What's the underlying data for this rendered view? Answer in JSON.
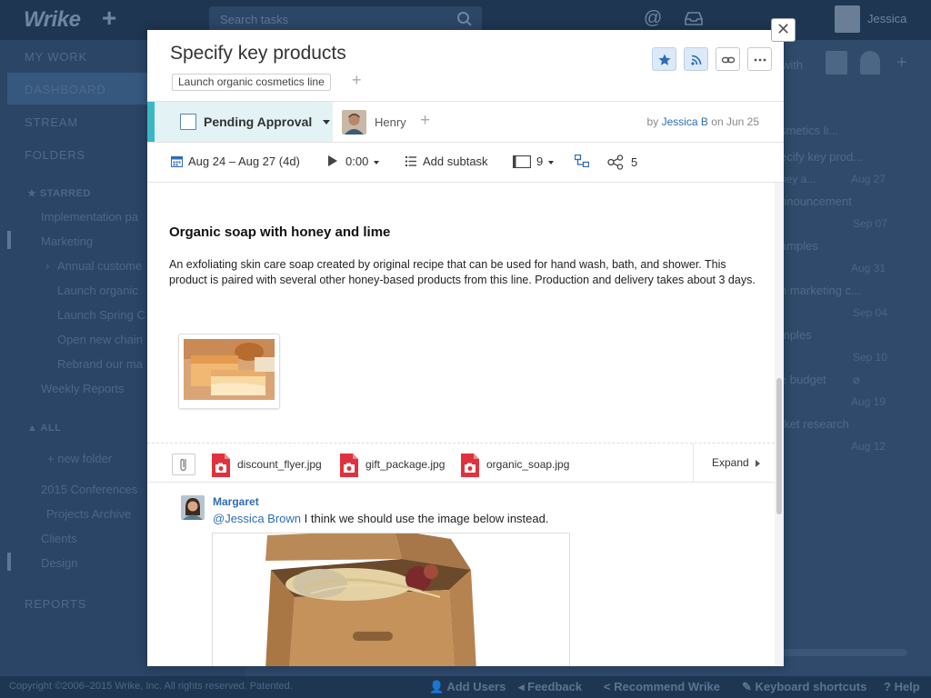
{
  "app": {
    "logo": "Wrike",
    "search_placeholder": "Search tasks",
    "user_name": "Jessica"
  },
  "sidebar": {
    "items": [
      "MY WORK",
      "DASHBOARD",
      "STREAM",
      "FOLDERS"
    ],
    "starred_label": "STARRED",
    "starred_items": [
      "Implementation pa",
      "Marketing",
      "Annual custome",
      "Launch organic",
      "Launch Spring C",
      "Open new chain",
      "Rebrand our ma",
      "Weekly Reports"
    ],
    "all_label": "ALL",
    "new_folder": "new folder",
    "all_items": [
      "2015 Conferences",
      "Projects Archive",
      "Clients",
      "Design"
    ],
    "reports": "REPORTS"
  },
  "right_panel": {
    "share_with": "with",
    "tasks": [
      {
        "title": "smetics li...",
        "date": ""
      },
      {
        "title": "ecify key prod...",
        "date": "Aug 27"
      },
      {
        "title": "ney a...",
        "date": ""
      },
      {
        "title": "nnouncement",
        "date": "Sep 07"
      },
      {
        "title": "amples",
        "date": "Aug 31"
      },
      {
        "title": "n marketing c...",
        "date": "Sep 04"
      },
      {
        "title": "mples",
        "date": "Sep 10"
      },
      {
        "title": "e budget",
        "date": "Aug 19"
      },
      {
        "title": "rket research",
        "date": "Aug 12"
      }
    ]
  },
  "footer": {
    "copyright": "Copyright ©2006–2015 Wrike, Inc. All rights reserved. Patented.",
    "links": [
      "Add Users",
      "Feedback",
      "Recommend Wrike",
      "Keyboard shortcuts",
      "Help"
    ]
  },
  "task": {
    "title": "Specify key products",
    "folder": "Launch organic cosmetics line",
    "status": "Pending Approval",
    "assignee": "Henry",
    "author_prefix": "by",
    "author": "Jessica B",
    "created_prefix": "on",
    "created": "Jun 25",
    "dates": "Aug 24 – Aug 27 (4d)",
    "time": "0:00",
    "add_subtask": "Add subtask",
    "subtask_count": "9",
    "followers_count": "5",
    "description_heading": "Organic soap with honey and lime",
    "description_body": "An exfoliating skin care soap created by original recipe that can be used for hand wash, bath, and shower. This product is paired with several other honey-based products from this line. Production and delivery takes about 3 days.",
    "attachments": [
      "discount_flyer.jpg",
      "gift_package.jpg",
      "organic_soap.jpg"
    ],
    "expand_label": "Expand"
  },
  "comment": {
    "author": "Margaret",
    "mention": "@Jessica Brown",
    "text": " I think we should use the image below instead."
  },
  "colors": {
    "accent": "#39b7c4",
    "link": "#2d6cb5",
    "status_bg": "#e3f2f4",
    "file_icon": "#e0323c"
  }
}
